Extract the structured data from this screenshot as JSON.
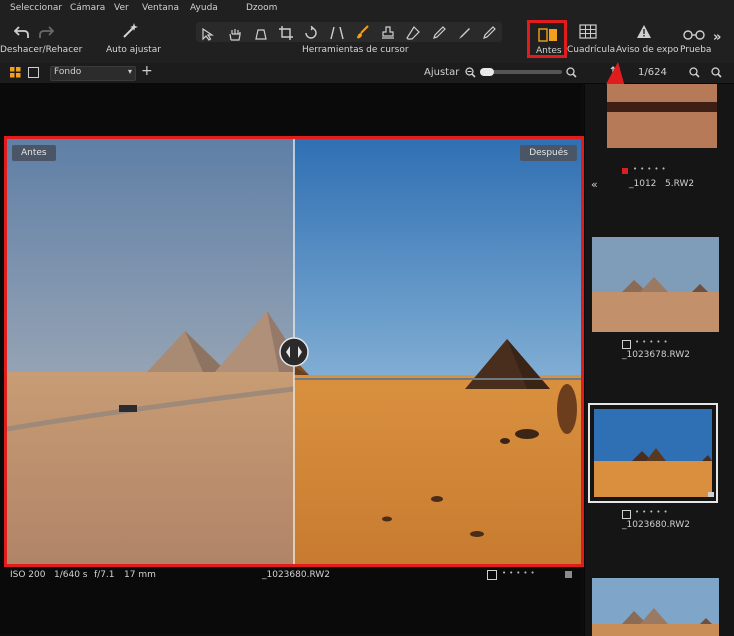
{
  "menu": {
    "items": [
      "Seleccionar",
      "Cámara",
      "Ver",
      "Ventana",
      "Ayuda"
    ],
    "dzoom": "Dzoom"
  },
  "toolbar": {
    "undo_redo_label": "Deshacer/Rehacer",
    "auto_adjust_label": "Auto ajustar",
    "cursor_tools_label": "Herramientas de cursor",
    "before_label": "Antes",
    "grid_label": "Cuadrícula",
    "exposure_warning_label": "Aviso de expo",
    "proof_label": "Prueba",
    "more": "»"
  },
  "secondary_bar": {
    "style_value": "Fondo",
    "fit_label": "Ajustar",
    "counter": "1/624"
  },
  "viewer": {
    "before_badge": "Antes",
    "after_badge": "Después",
    "info": {
      "iso": "ISO 200",
      "shutter": "1/640 s",
      "aperture": "f/7.1",
      "focal": "17 mm",
      "filename": "_1023680.RW2"
    }
  },
  "filmstrip": {
    "collapse": "«",
    "items": [
      {
        "caption": "_1012   5.RW2"
      },
      {
        "caption": "_1023678.RW2"
      },
      {
        "caption": "_1023680.RW2"
      }
    ]
  },
  "colors": {
    "annotation_red": "#e01c1c",
    "accent_orange": "#f2a01e",
    "background": "#0d0d0d",
    "panel": "#202020"
  }
}
